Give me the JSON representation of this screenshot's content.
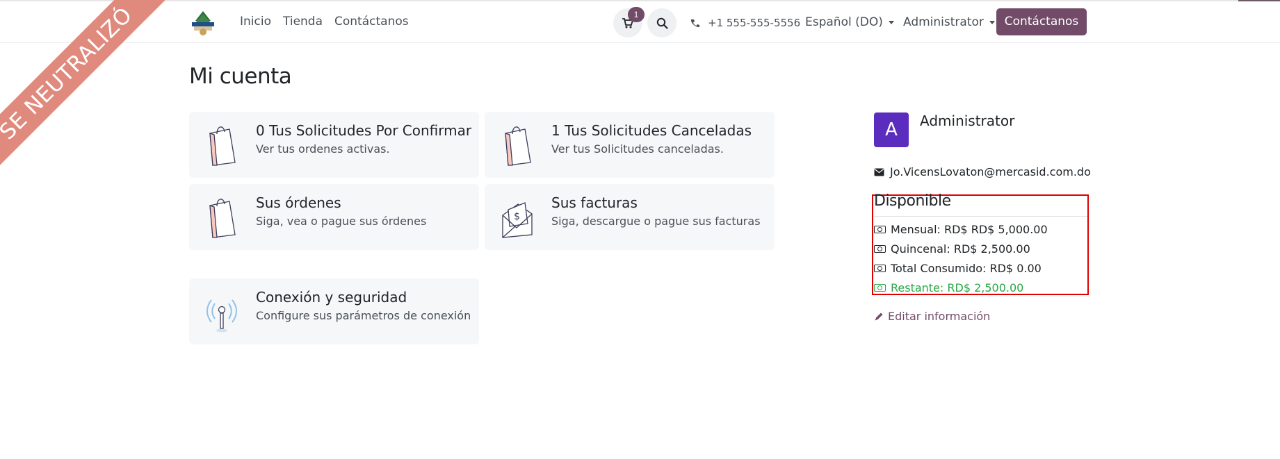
{
  "ribbon": {
    "text": "SE NEUTRALIZÓ"
  },
  "header": {
    "nav": [
      "Inicio",
      "Tienda",
      "Contáctanos"
    ],
    "cart_count": "1",
    "phone": "+1 555-555-5556",
    "language": "Español (DO)",
    "user_menu": "Administrator",
    "contact_button": "Contáctanos"
  },
  "page": {
    "title": "Mi cuenta"
  },
  "cards": [
    {
      "title": "0  Tus Solicitudes Por Confirmar",
      "subtitle": "Ver tus ordenes activas.",
      "icon": "shopping-bag-icon"
    },
    {
      "title": "1 Tus Solicitudes Canceladas",
      "subtitle": "Ver tus Solicitudes canceladas.",
      "icon": "shopping-bag-icon"
    },
    {
      "title": "Sus órdenes",
      "subtitle": "Siga, vea o pague sus órdenes",
      "icon": "shopping-bag-icon"
    },
    {
      "title": "Sus facturas",
      "subtitle": "Siga, descargue o pague sus facturas",
      "icon": "invoice-envelope-icon"
    },
    {
      "title": "Conexión y seguridad",
      "subtitle": "Configure sus parámetros de conexión",
      "icon": "antenna-icon"
    }
  ],
  "profile": {
    "avatar_letter": "A",
    "name": "Administrator",
    "email": "Jo.VicensLovaton@mercasid.com.do",
    "available_title": "Disponible",
    "balances": [
      {
        "label": "Mensual: RD$ RD$ 5,000.00"
      },
      {
        "label": "Quincenal: RD$ 2,500.00"
      },
      {
        "label": "Total Consumido: RD$ 0.00"
      },
      {
        "label": "Restante: RD$ 2,500.00"
      }
    ],
    "edit_label": "Editar información"
  },
  "colors": {
    "brand": "#714b67",
    "ribbon": "#e08a7d",
    "avatar": "#5b2dbf",
    "highlight": "#e00000",
    "success": "#28a745"
  }
}
